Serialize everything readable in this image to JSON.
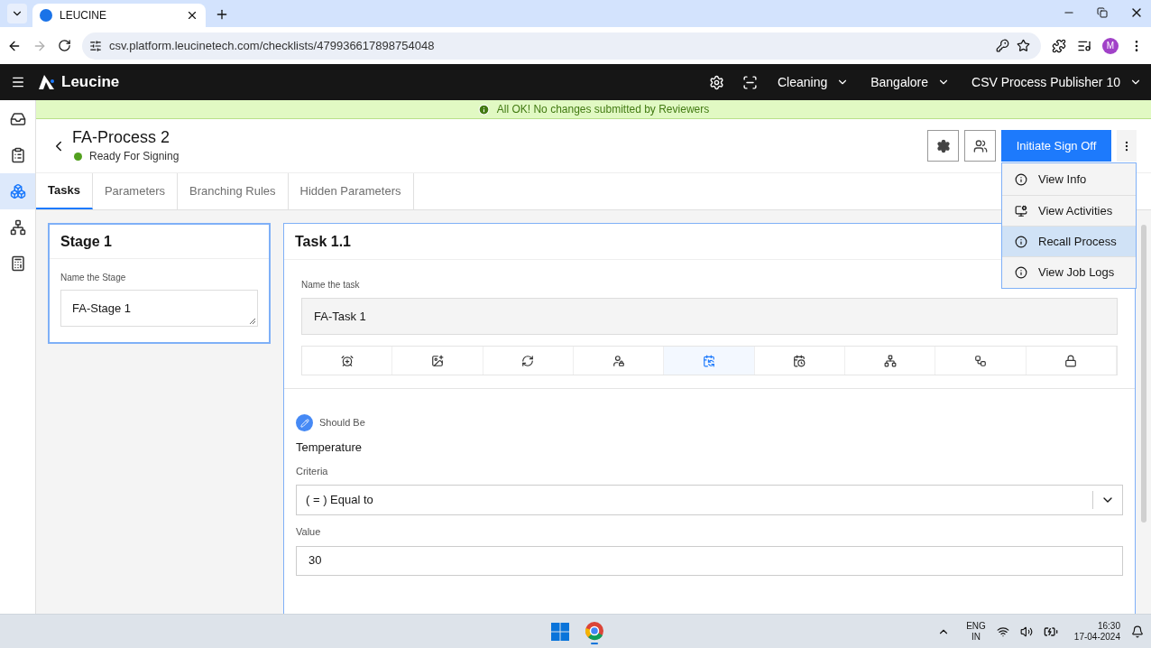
{
  "browser": {
    "tab_title": "LEUCINE",
    "url": "csv.platform.leucinetech.com/checklists/479936617898754048",
    "profile_initial": "M"
  },
  "header": {
    "brand": "Leucine",
    "selectors": [
      {
        "label": "Cleaning"
      },
      {
        "label": "Bangalore"
      },
      {
        "label": "CSV Process Publisher 10"
      }
    ]
  },
  "banner": {
    "text": "All OK! No changes submitted by Reviewers"
  },
  "sidebar": {
    "items": [
      {
        "selected": false
      },
      {
        "selected": false
      },
      {
        "selected": true
      },
      {
        "selected": false
      },
      {
        "selected": false
      }
    ]
  },
  "page": {
    "title": "FA-Process 2",
    "status": {
      "label": "Ready For Signing",
      "color": "#52a01e"
    },
    "primary_action": "Initiate Sign Off"
  },
  "menu": {
    "items": [
      {
        "label": "View Info",
        "selected": false
      },
      {
        "label": "View Activities",
        "selected": false
      },
      {
        "label": "Recall Process",
        "selected": true
      },
      {
        "label": "View Job Logs",
        "selected": false
      }
    ]
  },
  "tabs": [
    {
      "label": "Tasks",
      "selected": true
    },
    {
      "label": "Parameters",
      "selected": false
    },
    {
      "label": "Branching Rules",
      "selected": false
    },
    {
      "label": "Hidden Parameters",
      "selected": false
    }
  ],
  "stage": {
    "title": "Stage 1",
    "field_label": "Name the Stage",
    "value": "FA-Stage 1"
  },
  "task": {
    "title": "Task 1.1",
    "field_label": "Name the task",
    "value": "FA-Task 1",
    "toolbar": [
      {
        "selected": false
      },
      {
        "selected": false
      },
      {
        "selected": false
      },
      {
        "selected": false
      },
      {
        "selected": true
      },
      {
        "selected": false
      },
      {
        "selected": false
      },
      {
        "selected": false
      },
      {
        "selected": false
      }
    ],
    "parameter": {
      "type_label": "Should Be",
      "name": "Temperature",
      "criteria_label": "Criteria",
      "criteria_value": "( = ) Equal to",
      "value_label": "Value",
      "value": "30"
    }
  },
  "taskbar": {
    "language": "ENG",
    "region": "IN",
    "time": "16:30",
    "date": "17-04-2024"
  }
}
